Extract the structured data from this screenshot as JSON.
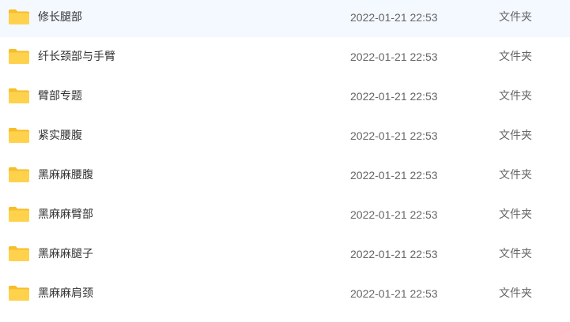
{
  "colors": {
    "folder": "#FFD24D",
    "folder_tab": "#F7BE2A",
    "name_text": "#333333",
    "meta_text": "#666666"
  },
  "files": [
    {
      "icon": "folder-icon",
      "name": "修长腿部",
      "modified": "2022-01-21 22:53",
      "type": "文件夹"
    },
    {
      "icon": "folder-icon",
      "name": "纤长颈部与手臂",
      "modified": "2022-01-21 22:53",
      "type": "文件夹"
    },
    {
      "icon": "folder-icon",
      "name": "臂部专题",
      "modified": "2022-01-21 22:53",
      "type": "文件夹"
    },
    {
      "icon": "folder-icon",
      "name": "紧实腰腹",
      "modified": "2022-01-21 22:53",
      "type": "文件夹"
    },
    {
      "icon": "folder-icon",
      "name": "黑麻麻腰腹",
      "modified": "2022-01-21 22:53",
      "type": "文件夹"
    },
    {
      "icon": "folder-icon",
      "name": "黑麻麻臂部",
      "modified": "2022-01-21 22:53",
      "type": "文件夹"
    },
    {
      "icon": "folder-icon",
      "name": "黑麻麻腿子",
      "modified": "2022-01-21 22:53",
      "type": "文件夹"
    },
    {
      "icon": "folder-icon",
      "name": "黑麻麻肩颈",
      "modified": "2022-01-21 22:53",
      "type": "文件夹"
    }
  ]
}
